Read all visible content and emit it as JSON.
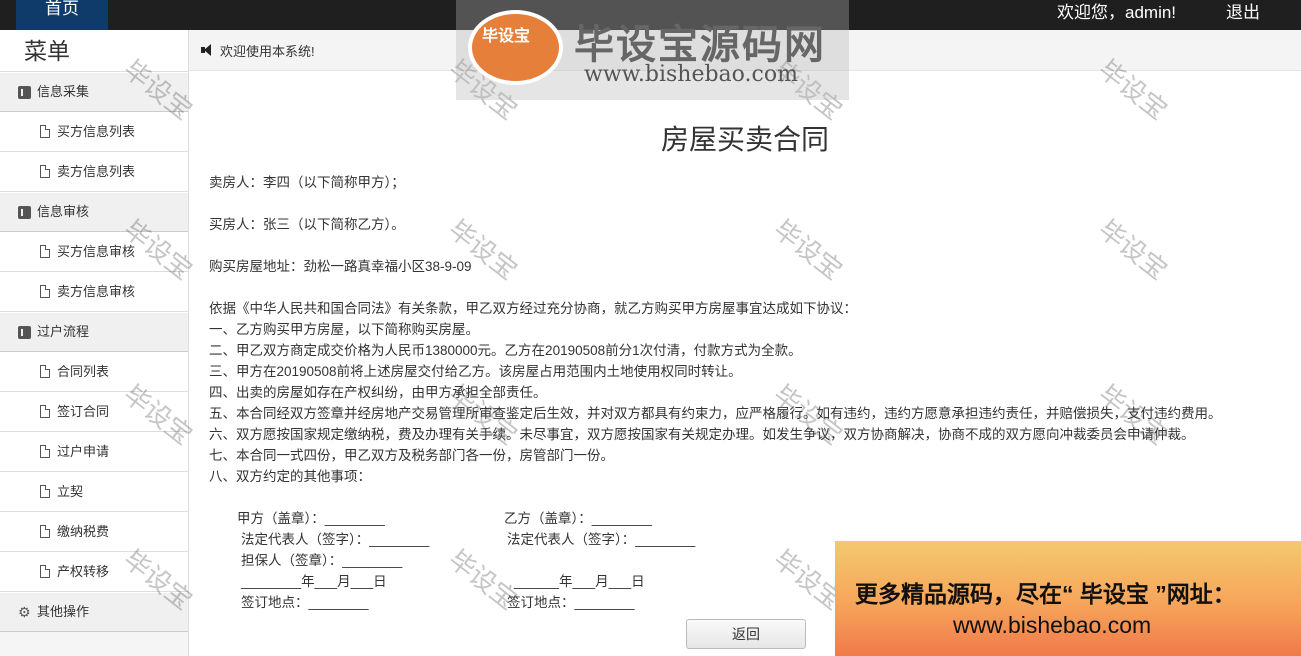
{
  "topbar": {
    "home_tab": "首页",
    "welcome": "欢迎您，admin!",
    "logout": "退出"
  },
  "sidebar": {
    "title": "菜单",
    "sections": [
      {
        "label": "信息采集",
        "items": [
          "买方信息列表",
          "卖方信息列表"
        ]
      },
      {
        "label": "信息审核",
        "items": [
          "买方信息审核",
          "卖方信息审核"
        ]
      },
      {
        "label": "过户流程",
        "items": [
          "合同列表",
          "签订合同",
          "过户申请",
          "立契",
          "缴纳税费",
          "产权转移"
        ]
      },
      {
        "label": "其他操作",
        "items": []
      }
    ]
  },
  "main": {
    "notice": "欢迎使用本系统!",
    "contract": {
      "title": "房屋买卖合同",
      "seller": "卖房人：李四（以下简称甲方）；",
      "buyer": "买房人：张三（以下简称乙方）。",
      "address": "购买房屋地址：劲松一路真幸福小区38-9-09",
      "intro": "依据《中华人民共和国合同法》有关条款，甲乙双方经过充分协商，就乙方购买甲方房屋事宜达成如下协议：",
      "clauses": [
        "一、乙方购买甲方房屋，以下简称购买房屋。",
        "二、甲乙双方商定成交价格为人民币1380000元。乙方在20190508前分1次付清，付款方式为全款。",
        "三、甲方在20190508前将上述房屋交付给乙方。该房屋占用范围内土地使用权同时转让。",
        "四、出卖的房屋如存在产权纠纷，由甲方承担全部责任。",
        "五、本合同经双方签章并经房地产交易管理所审查鉴定后生效，并对双方都具有约束力，应严格履行。如有违约，违约方愿意承担违约责任，并赔偿损失，支付违约费用。",
        "六、双方愿按国家规定缴纳税，费及办理有关手续。未尽事宜，双方愿按国家有关规定办理。如发生争议，双方协商解决，协商不成的双方愿向冲裁委员会申请仲裁。",
        "七、本合同一式四份，甲乙双方及税务部门各一份，房管部门一份。",
        "八、双方约定的其他事项："
      ],
      "signatures": {
        "party_a_seal": "甲方（盖章）：________",
        "party_b_seal": "乙方（盖章）：________",
        "party_a_rep": "法定代表人（签字）：________",
        "party_b_rep": "法定代表人（签字）：________",
        "guarantor": "担保人（签章）：________",
        "date_a": "________年___月___日",
        "date_b": "______年___月___日",
        "place_a": "签订地点：________",
        "place_b": "签订地点：________"
      }
    },
    "back_button": "返回"
  },
  "overlay": {
    "watermark": "毕设宝",
    "brand_name": "毕设宝源码网",
    "brand_logo_text": "毕设宝",
    "brand_url": "www.bishebao.com",
    "promo_line1": "更多精品源码，尽在“ 毕设宝 ”网址：",
    "promo_line2": "www.bishebao.com"
  }
}
